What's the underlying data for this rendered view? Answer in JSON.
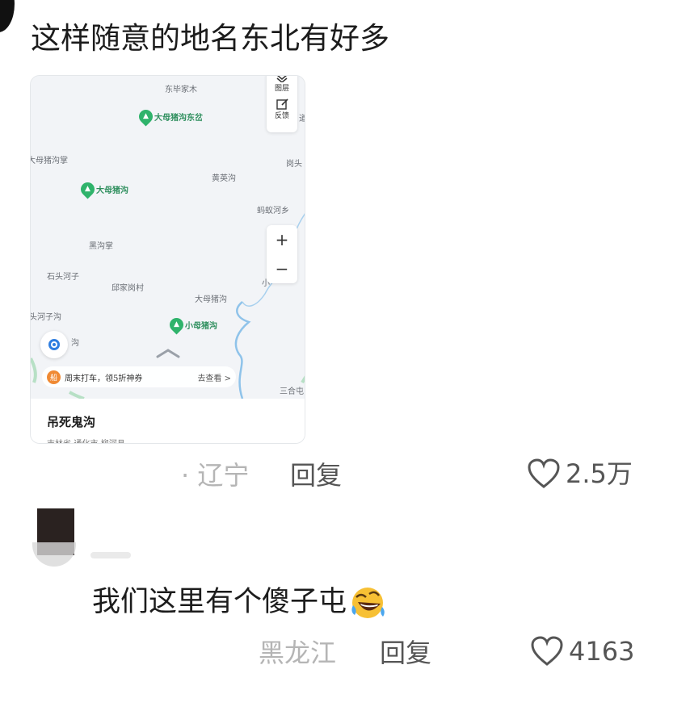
{
  "comment1": {
    "text": "这样随意的地名东北有好多",
    "map": {
      "places": [
        {
          "id": "p1",
          "label": "东毕家木"
        },
        {
          "id": "p2",
          "label": "大母猪沟掌"
        },
        {
          "id": "p3",
          "label": "黄英沟"
        },
        {
          "id": "p4",
          "label": "岗头"
        },
        {
          "id": "p5",
          "label": "蚂蚁河乡"
        },
        {
          "id": "p6",
          "label": "黑沟掌"
        },
        {
          "id": "p7",
          "label": "石头河子"
        },
        {
          "id": "p8",
          "label": "邱家岗村"
        },
        {
          "id": "p9",
          "label": "大母猪沟"
        },
        {
          "id": "p10",
          "label": "头河子沟"
        },
        {
          "id": "p11",
          "label": "沟"
        },
        {
          "id": "p12",
          "label": "三合屯"
        },
        {
          "id": "p13",
          "label": "道"
        },
        {
          "id": "p14",
          "label": "小"
        }
      ],
      "pois": [
        {
          "id": "poi1",
          "label": "大母猪沟东岔"
        },
        {
          "id": "poi2",
          "label": "大母猪沟"
        },
        {
          "id": "poi3",
          "label": "小母猪沟"
        }
      ],
      "controls": {
        "layers_label": "图层",
        "feedback_label": "反馈",
        "zoom_in": "+",
        "zoom_out": "−"
      },
      "promo": {
        "badge": "船",
        "text": "周末打车，领5折神券",
        "link": "去查看 >"
      },
      "place_name": "吊死鬼沟",
      "place_address": "吉林省-通化市-柳河县"
    },
    "location": "· 辽宁",
    "reply": "回复",
    "likes": "2.5万"
  },
  "comment2": {
    "text": "我们这里有个傻子屯",
    "location": "黑龙江",
    "reply": "回复",
    "likes": "4163"
  },
  "colors": {
    "poi_green": "#2fb36b",
    "river_blue": "#8fc3ea",
    "locate_blue": "#2f7ee0",
    "promo_orange": "#f08a34"
  },
  "icons": [
    "layers-icon",
    "feedback-icon",
    "locate-icon",
    "heart-icon",
    "rofl-emoji-icon",
    "chevron-up-icon",
    "tree-pin-icon"
  ]
}
